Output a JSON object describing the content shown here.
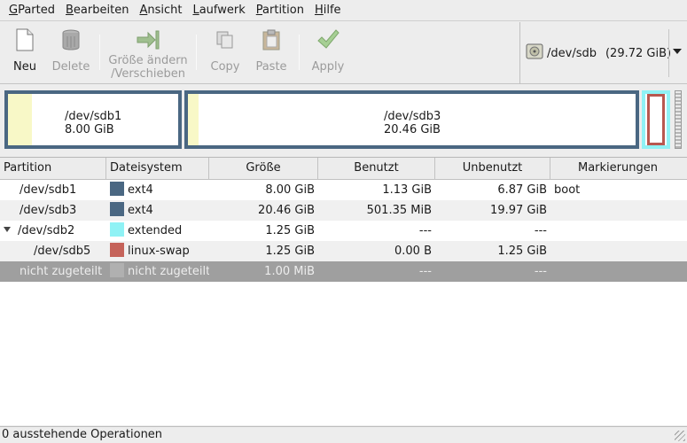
{
  "menu": [
    {
      "mnemonic": "G",
      "rest": "Parted"
    },
    {
      "mnemonic": "B",
      "rest": "earbeiten"
    },
    {
      "mnemonic": "A",
      "rest": "nsicht"
    },
    {
      "mnemonic": "L",
      "rest": "aufwerk"
    },
    {
      "mnemonic": "P",
      "rest": "artition"
    },
    {
      "mnemonic": "H",
      "rest": "ilfe"
    }
  ],
  "toolbar": {
    "new_label": "Neu",
    "delete_label": "Delete",
    "resize_label_1": "Größe ändern",
    "resize_label_2": "/Verschieben",
    "copy_label": "Copy",
    "paste_label": "Paste",
    "apply_label": "Apply"
  },
  "device": {
    "name": "/dev/sdb",
    "size": "(29.72 GiB)"
  },
  "visual": {
    "sdb1": {
      "name": "/dev/sdb1",
      "size": "8.00 GiB",
      "used_fraction": 0.14
    },
    "sdb3": {
      "name": "/dev/sdb3",
      "size": "20.46 GiB",
      "used_fraction": 0.024
    }
  },
  "table": {
    "headers": [
      "Partition",
      "Dateisystem",
      "Größe",
      "Benutzt",
      "Unbenutzt",
      "Markierungen"
    ],
    "rows": [
      {
        "partition": "/dev/sdb1",
        "fs": "ext4",
        "color": "#4a6782",
        "size": "8.00 GiB",
        "used": "1.13 GiB",
        "unused": "6.87 GiB",
        "flags": "boot"
      },
      {
        "partition": "/dev/sdb3",
        "fs": "ext4",
        "color": "#4a6782",
        "size": "20.46 GiB",
        "used": "501.35 MiB",
        "unused": "19.97 GiB",
        "flags": ""
      },
      {
        "partition": "/dev/sdb2",
        "fs": "extended",
        "color": "#8ff2f5",
        "size": "1.25 GiB",
        "used": "---",
        "unused": "---",
        "flags": ""
      },
      {
        "partition": "/dev/sdb5",
        "fs": "linux-swap",
        "color": "#c5635a",
        "size": "1.25 GiB",
        "used": "0.00 B",
        "unused": "1.25 GiB",
        "flags": ""
      },
      {
        "partition": "nicht zugeteilt",
        "fs": "nicht zugeteilt",
        "color": "#b0b0b0",
        "size": "1.00 MiB",
        "used": "---",
        "unused": "---",
        "flags": ""
      }
    ]
  },
  "status": {
    "text": "0 ausstehende Operationen"
  }
}
